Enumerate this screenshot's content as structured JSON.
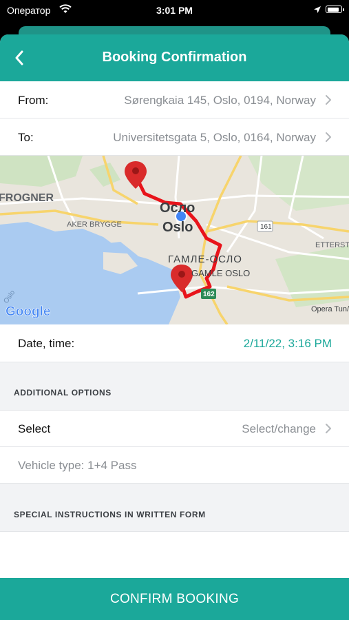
{
  "status_bar": {
    "carrier": "Оператор",
    "time": "3:01 PM",
    "battery_level": 0.9
  },
  "nav": {
    "title": "Booking Confirmation",
    "back_icon": "chevron-left-icon"
  },
  "route": {
    "from_label": "From:",
    "from_value": "Sørengkaia 145, Oslo, 0194, Norway",
    "to_label": "To:",
    "to_value": "Universitetsgata 5, Oslo, 0164, Norway"
  },
  "map": {
    "labels": {
      "frogner": "FROGNER",
      "oslo_cyr": "Осло",
      "oslo": "Oslo",
      "aker_brygge": "AKER BRYGGE",
      "gamle_oslo_cyr": "ГАМЛЕ-ОСЛО",
      "gamle_oslo": "GAMLE OSLO",
      "ettersta": "ETTERSTA",
      "opera": "Opera Tun/",
      "road_161": "161",
      "road_162": "162",
      "oslo_diag": "Oslo",
      "google": "Google"
    },
    "route_color": "#e8141b",
    "pin_color": "#d92b2b",
    "location_color": "#4285f4"
  },
  "datetime": {
    "label": "Date, time:",
    "value": "2/11/22, 3:16 PM",
    "value_color": "#1ba89a"
  },
  "additional_options": {
    "header": "ADDITIONAL OPTIONS",
    "select_label": "Select",
    "select_value": "Select/change",
    "vehicle_type": "Vehicle type: 1+4 Pass"
  },
  "special_instructions": {
    "header": "SPECIAL INSTRUCTIONS IN WRITTEN FORM"
  },
  "footer": {
    "confirm_label": "CONFIRM BOOKING"
  },
  "colors": {
    "accent": "#1ba89a",
    "accent_dark": "#1f9488"
  }
}
